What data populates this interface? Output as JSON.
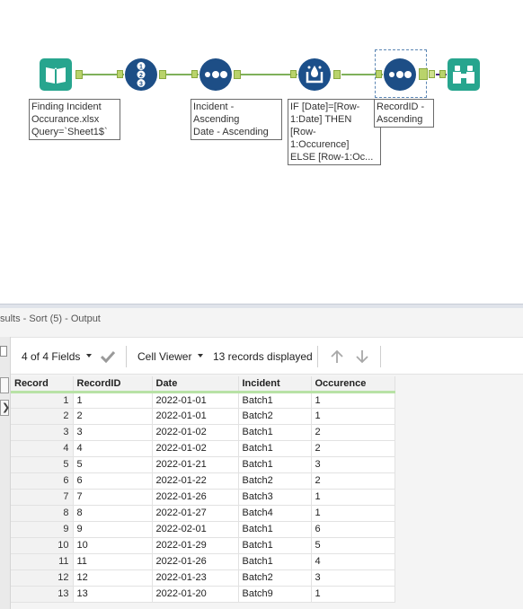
{
  "workflow": {
    "tools": [
      {
        "name": "input-data-tool",
        "icon": "book-icon"
      },
      {
        "name": "record-id-tool",
        "icon": "numbered-list-icon"
      },
      {
        "name": "sort-tool-1",
        "icon": "three-dots-icon"
      },
      {
        "name": "multi-row-formula-tool",
        "icon": "formula-drop-icon"
      },
      {
        "name": "sort-tool-2",
        "icon": "three-dots-icon"
      },
      {
        "name": "browse-tool",
        "icon": "binoculars-icon"
      }
    ],
    "annotations": {
      "input": "Finding Incident\nOccurance.xlsx\nQuery=`Sheet1$`",
      "sort1": "Incident -\nAscending\nDate - Ascending",
      "formula": "IF [Date]=[Row-\n1:Date] THEN\n[Row-\n1:Occurence]\nELSE [Row-1:Oc...",
      "sort2": "RecordID -\nAscending"
    }
  },
  "results": {
    "title": "sults - Sort (5) - Output",
    "fields_label": "4 of 4 Fields",
    "viewer_label": "Cell Viewer",
    "records_label": "13 records displayed",
    "columns": [
      "Record",
      "RecordID",
      "Date",
      "Incident",
      "Occurence"
    ],
    "rows": [
      [
        "1",
        "1",
        "2022-01-01",
        "Batch1",
        "1"
      ],
      [
        "2",
        "2",
        "2022-01-01",
        "Batch2",
        "1"
      ],
      [
        "3",
        "3",
        "2022-01-02",
        "Batch1",
        "2"
      ],
      [
        "4",
        "4",
        "2022-01-02",
        "Batch1",
        "2"
      ],
      [
        "5",
        "5",
        "2022-01-21",
        "Batch1",
        "3"
      ],
      [
        "6",
        "6",
        "2022-01-22",
        "Batch2",
        "2"
      ],
      [
        "7",
        "7",
        "2022-01-26",
        "Batch3",
        "1"
      ],
      [
        "8",
        "8",
        "2022-01-27",
        "Batch4",
        "1"
      ],
      [
        "9",
        "9",
        "2022-02-01",
        "Batch1",
        "6"
      ],
      [
        "10",
        "10",
        "2022-01-29",
        "Batch1",
        "5"
      ],
      [
        "11",
        "11",
        "2022-01-26",
        "Batch1",
        "4"
      ],
      [
        "12",
        "12",
        "2022-01-23",
        "Batch2",
        "3"
      ],
      [
        "13",
        "13",
        "2022-01-20",
        "Batch9",
        "1"
      ]
    ]
  },
  "colors": {
    "accent_green": "#b9d36b",
    "tool_blue": "#1d4e86",
    "tool_teal": "#1fa08f"
  }
}
